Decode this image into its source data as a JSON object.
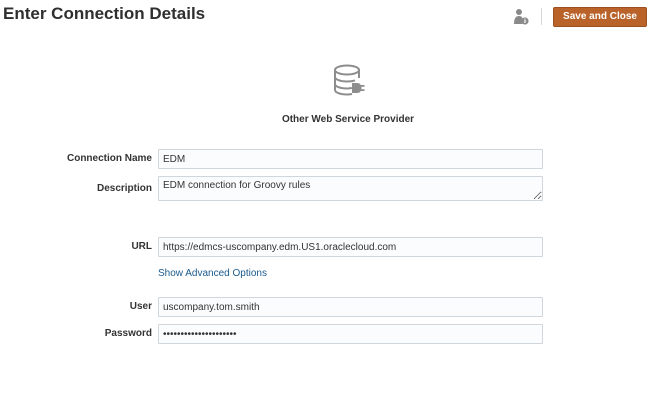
{
  "header": {
    "title": "Enter Connection Details",
    "user_icon": "user-info-icon",
    "save_close_label": "Save and Close"
  },
  "provider": {
    "icon": "database-connector-icon",
    "name": "Other Web Service Provider"
  },
  "form": {
    "connection_name": {
      "label": "Connection Name",
      "value": "EDM"
    },
    "description": {
      "label": "Description",
      "value": "EDM connection for Groovy rules"
    },
    "url": {
      "label": "URL",
      "value": "https://edmcs-uscompany.edm.US1.oraclecloud.com"
    },
    "advanced_link": "Show Advanced Options",
    "user": {
      "label": "User",
      "value": "uscompany.tom.smith"
    },
    "password": {
      "label": "Password",
      "value": "•••••••••••••••••••••"
    }
  },
  "colors": {
    "primary_button": "#b9632a",
    "link": "#1a5a8c",
    "input_border": "#cfd6dc"
  }
}
